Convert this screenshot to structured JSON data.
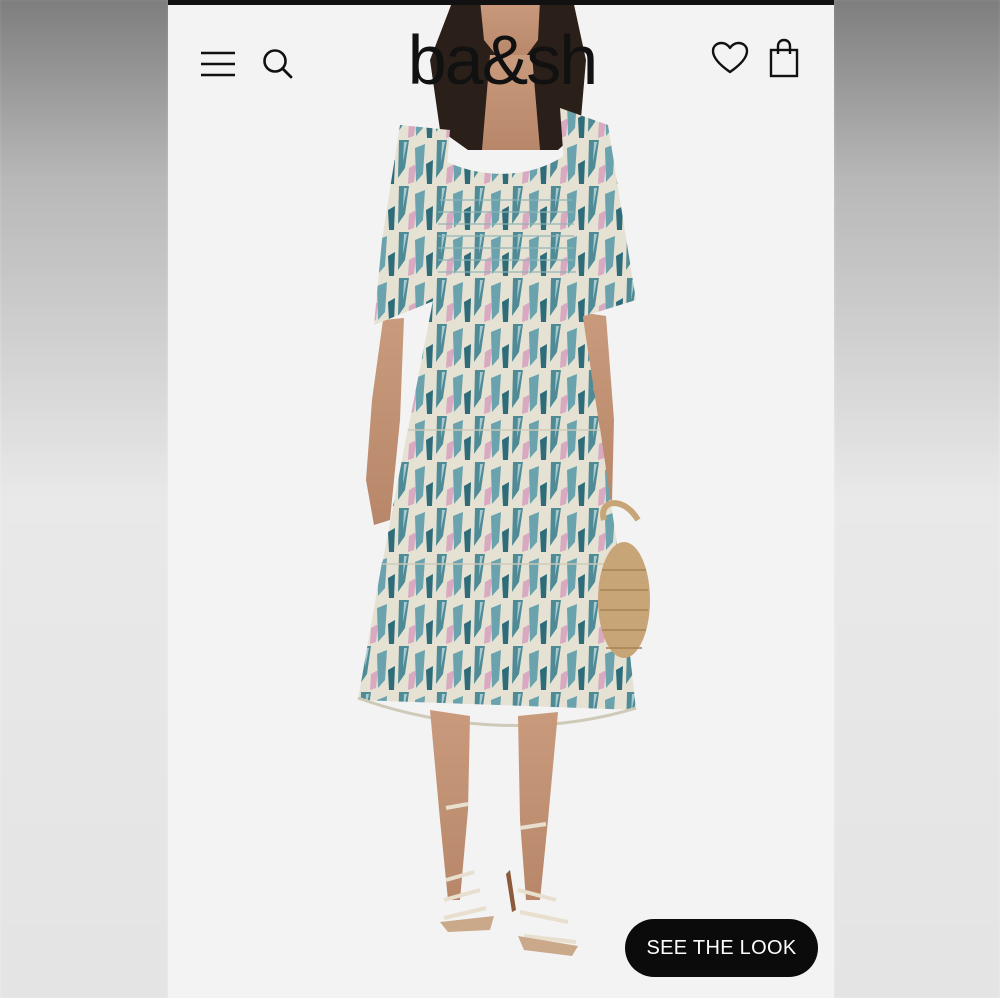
{
  "header": {
    "brand": "ba&sh",
    "menu_icon": "menu-icon",
    "search_icon": "search-icon",
    "wishlist_icon": "heart-icon",
    "bag_icon": "shopping-bag-icon"
  },
  "hero": {
    "image": "model-in-printed-tiered-midi-dress",
    "cta_label": "SEE THE LOOK"
  },
  "colors": {
    "background": "#f3f3f3",
    "text": "#111111",
    "cta_background": "#0b0b0b",
    "cta_text": "#ffffff",
    "dress_teal": "#4e8a95",
    "dress_cream": "#e8e4d6"
  }
}
